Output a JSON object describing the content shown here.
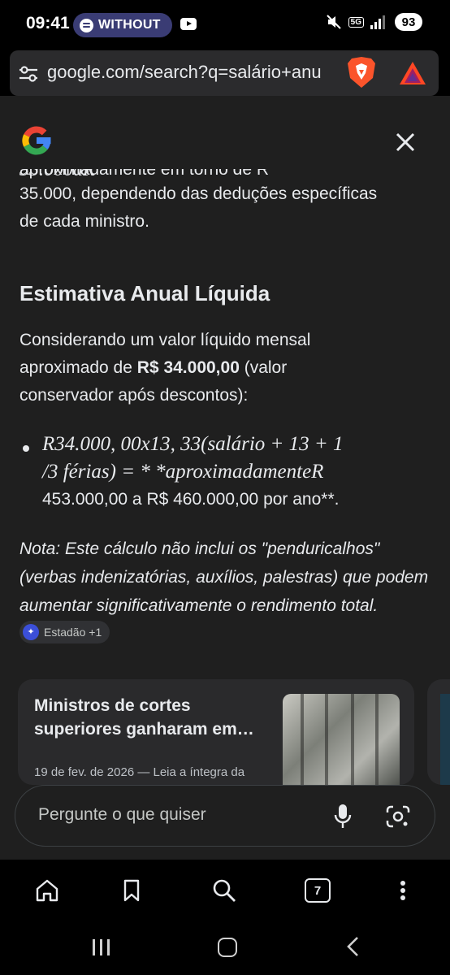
{
  "status_bar": {
    "time": "09:41",
    "media_pill": "WITHOUT",
    "network": "5G",
    "battery": "93"
  },
  "browser": {
    "url": "google.com/search?q=salário+anu"
  },
  "answer": {
    "top_partial_text": "aproximadamente em torno de R",
    "top_partial_math": "33.000aR",
    "paragraph1_lines": [
      "35.000, dependendo das deduções específicas",
      "de cada ministro."
    ],
    "heading": "Estimativa Anual Líquida",
    "paragraph2_line1": "Considerando um valor líquido mensal",
    "paragraph2_line2_before": "aproximado de ",
    "paragraph2_line2_bold": "R$ 34.000,00",
    "paragraph2_line2_after": " (valor",
    "paragraph2_line3": "conservador após descontos):",
    "bullet_math_line1": "R34.000, 00x13, 33(salário + 13 + 1",
    "bullet_math_line2": "/3 férias) =  * *aproximadamenteR",
    "bullet_text_line3": "453.000,00 a R$ 460.000,00 por ano**.",
    "note": "Nota: Este cálculo não inclui os \"penduricalhos\" (verbas indenizatórias, auxílios, palestras) que podem aumentar significativamente o rendimento total.",
    "source_chip": "Estadão +1"
  },
  "card": {
    "title": "Ministros de cortes superiores ganharam em…",
    "meta": "19 de fev. de 2026 — Leia a íntegra da"
  },
  "ask": {
    "placeholder": "Pergunte o que quiser"
  },
  "toolbar": {
    "tab_count": "7"
  }
}
